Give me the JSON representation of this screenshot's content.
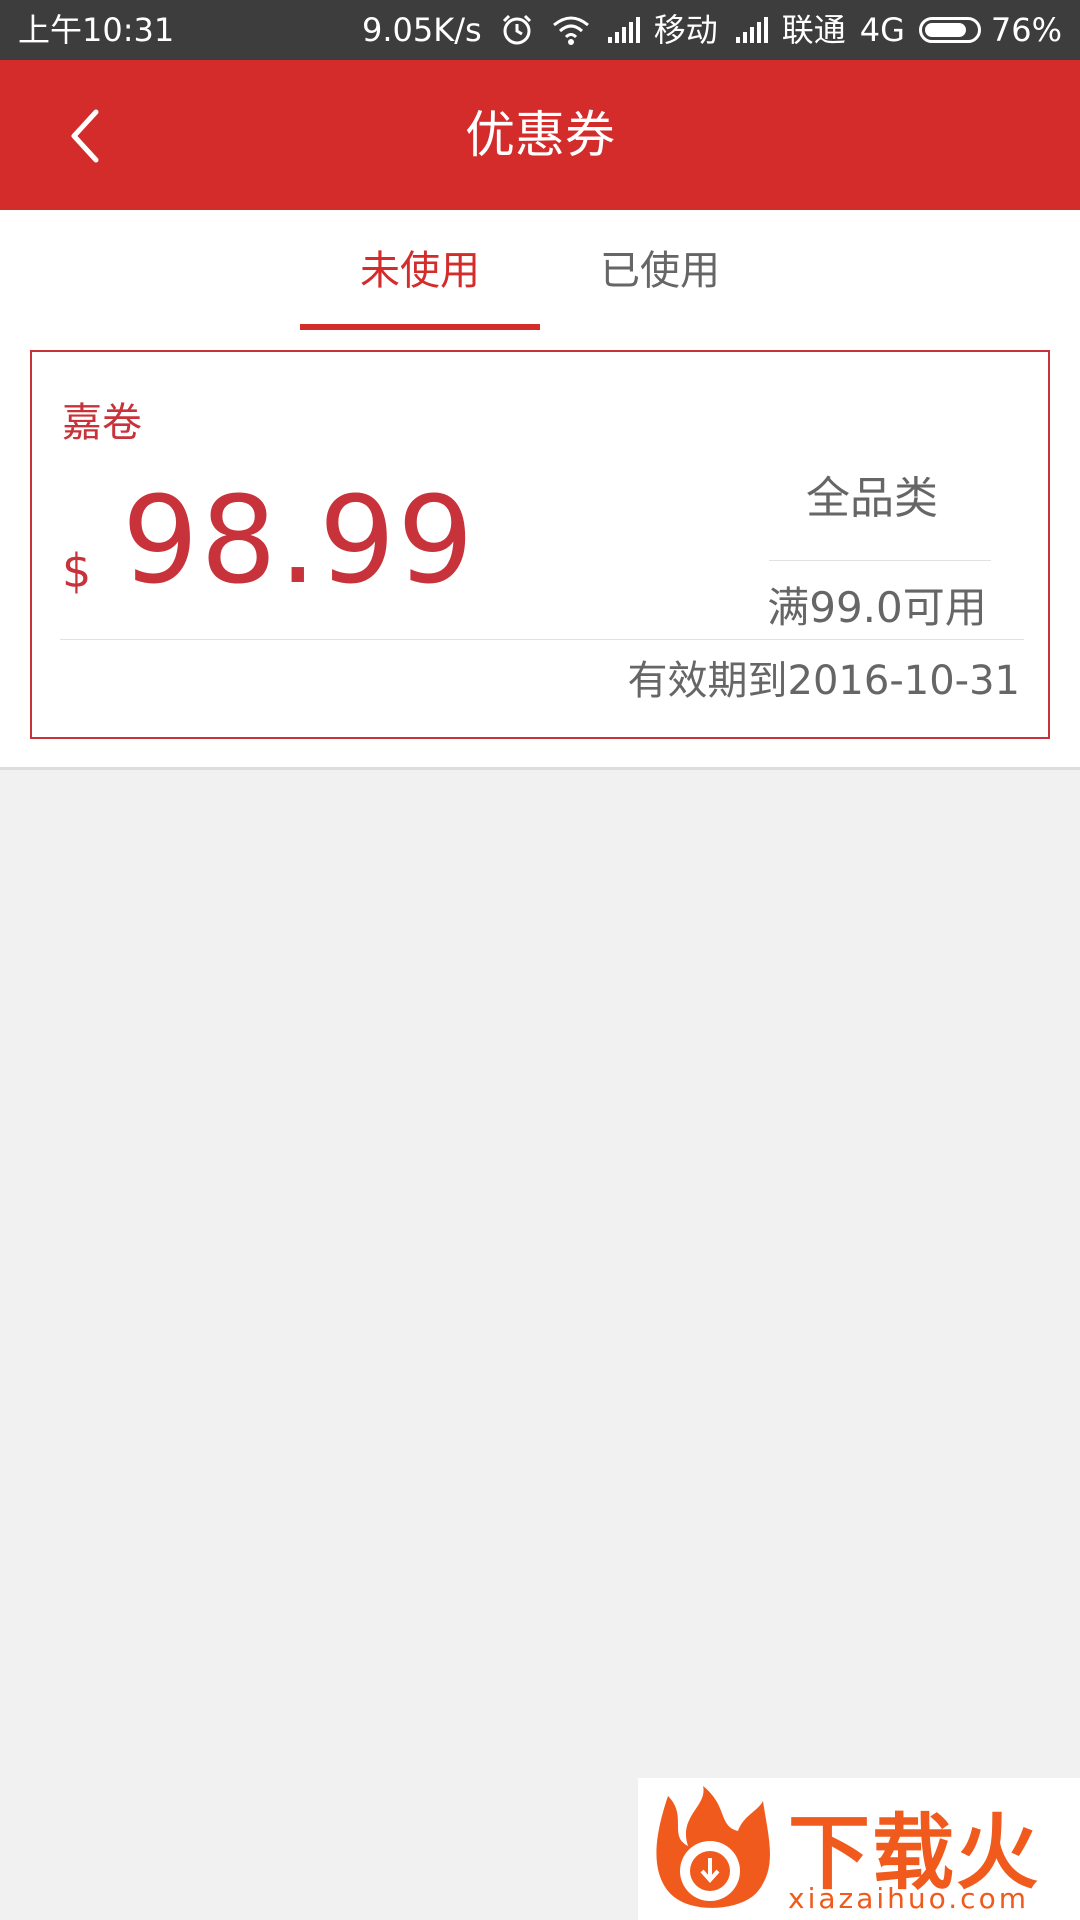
{
  "status_bar": {
    "time": "上午10:31",
    "speed": "9.05K/s",
    "carrier1": "移动",
    "carrier2": "联通",
    "network": "4G",
    "battery": "76%",
    "battery_level": 0.76
  },
  "header": {
    "title": "优惠券",
    "back_icon": "back-arrow-icon"
  },
  "tabs": [
    {
      "label": "未使用",
      "active": true
    },
    {
      "label": "已使用",
      "active": false
    }
  ],
  "coupons": [
    {
      "name": "嘉卷",
      "currency": "$",
      "amount": "98.99",
      "category": "全品类",
      "condition": "满99.0可用",
      "validity": "有效期到2016-10-31"
    }
  ],
  "watermark": {
    "brand": "下载火",
    "url": "xiazaihuo.com"
  },
  "colors": {
    "accent": "#d42b2b",
    "status_bar": "#3d3d3d",
    "background": "#f1f1f1",
    "text_secondary": "#666666",
    "watermark": "#f05a1c"
  }
}
